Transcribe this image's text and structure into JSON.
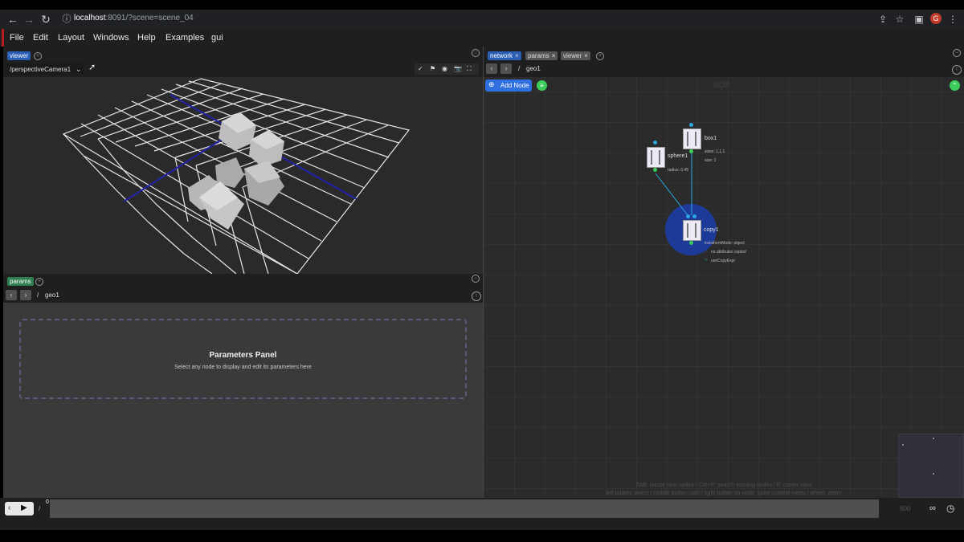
{
  "browser": {
    "url_host": "localhost",
    "url_path": ":8091/?scene=scene_04",
    "avatar_letter": "G",
    "back_icon": "←",
    "forward_icon": "→",
    "reload_icon": "↻",
    "info_icon": "ⓘ",
    "share_icon": "⇪",
    "star_icon": "☆",
    "sidebar_icon": "▣",
    "menu_icon": "⋮"
  },
  "menubar": {
    "items": [
      "File",
      "Edit",
      "Layout",
      "Windows",
      "Help",
      "Examples",
      "gui"
    ]
  },
  "viewer": {
    "tab_label": "viewer",
    "camera_select": "/perspectiveCamera1",
    "toolbar_icons": [
      "✓",
      "⚑",
      "◉",
      "📷",
      "⛶"
    ]
  },
  "params": {
    "tab_label": "params",
    "path": "geo1",
    "panel_title": "Parameters Panel",
    "panel_hint": "Select any node to display and edit its parameters here"
  },
  "network": {
    "tabs": [
      {
        "label": "network",
        "active": true
      },
      {
        "label": "params",
        "active": false
      },
      {
        "label": "viewer",
        "active": false
      }
    ],
    "path": "geo1",
    "add_node_label": "Add Node",
    "context_label": "SOP",
    "nodes": {
      "box1": {
        "name": "box1",
        "params": [
          "sizes: 1,1,1",
          "size: 1"
        ]
      },
      "sphere1": {
        "name": "sphere1",
        "params": [
          "radius: 0.45"
        ]
      },
      "copy1": {
        "name": "copy1",
        "params": [
          "transformMode: object",
          "no attributes copied",
          "useCopyExpr"
        ]
      }
    },
    "help_line1": "TAB: create new nodes / Ctrl+P: search existing nodes / F: center view",
    "help_line2": "left button: select / middle button: pan / right button on node: open context menu / wheel: zoom"
  },
  "timeline": {
    "frame": "0",
    "end_frame": "600",
    "infinity_icon": "∞",
    "clock_icon": "◷"
  },
  "colors": {
    "accent_blue": "#2f6fe0",
    "active_tab": "#2b5fb5",
    "params_tab": "#2e7d4f",
    "node_select": "#1e3a99",
    "port_blue": "#29a8e0",
    "port_green": "#3ccc5c"
  }
}
